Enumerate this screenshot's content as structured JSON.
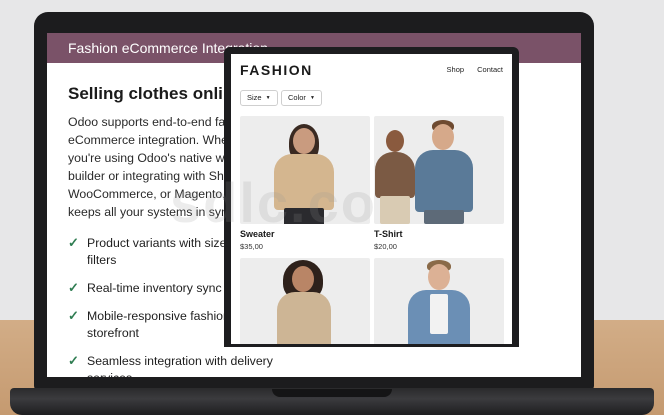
{
  "header": {
    "title": "Fashion eCommerce Integration"
  },
  "intro": {
    "heading": "Selling clothes online?",
    "body": "Odoo supports end-to-end fashion eCommerce integration. Whether you're using Odoo's native web builder or integrating with Shopify, WooCommerce, or Magento, Odoo keeps all your systems in sync."
  },
  "features": [
    "Product variants with size/color filters",
    "Real-time inventory sync",
    "Mobile-responsive fashion storefront",
    "Seamless integration with delivery services"
  ],
  "store": {
    "brand": "FASHION",
    "nav": [
      "Shop",
      "Contact"
    ],
    "filters": [
      "Size",
      "Color"
    ],
    "products": [
      {
        "name": "Sweater",
        "price": "$35,00"
      },
      {
        "name": "T-Shirt",
        "price": "$20,00"
      },
      {
        "name": "",
        "price": ""
      },
      {
        "name": "",
        "price": ""
      }
    ]
  },
  "colors": {
    "header": "#7a5268",
    "check": "#2f7d52"
  },
  "icons": {
    "feature_bullet": "check-icon",
    "filter_toggle": "caret-down-icon"
  },
  "watermark": "sdlc.co"
}
